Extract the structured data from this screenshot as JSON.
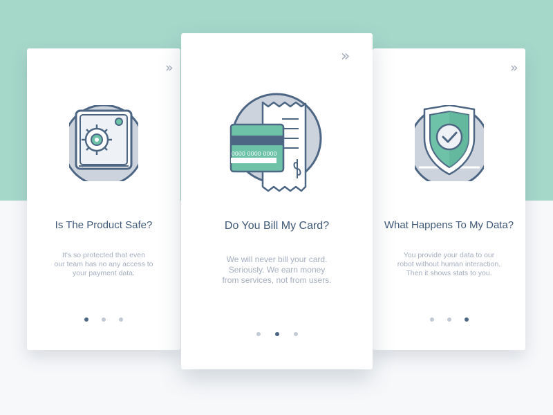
{
  "colors": {
    "background_top": "#a6d8ca",
    "background_bottom": "#f7f8fa",
    "card": "#ffffff",
    "accent_green": "#6dc2a8",
    "outline_navy": "#4d6684",
    "title_text": "#3f5877",
    "body_text": "#a5aebf",
    "dot_inactive": "#c2cad5",
    "dot_active": "#4d6684"
  },
  "next_icon": "double-chevron-right-icon",
  "cards": [
    {
      "icon": "safe-icon",
      "title": "Is The Product Safe?",
      "description": [
        "It's so protected that even",
        "our team has no any access to",
        "your payment data."
      ],
      "active_dot": 0
    },
    {
      "icon": "credit-card-receipt-icon",
      "title": "Do You Bill My Card?",
      "card_number": "0000 0000 0000",
      "description": [
        "We will never bill your card.",
        "Seriously. We earn money",
        "from services, not from users."
      ],
      "active_dot": 1
    },
    {
      "icon": "shield-check-icon",
      "title": "What Happens To My Data?",
      "description": [
        "You provide your data to our",
        "robot without human interaction.",
        "Then it shows stats to you."
      ],
      "active_dot": 2
    }
  ]
}
